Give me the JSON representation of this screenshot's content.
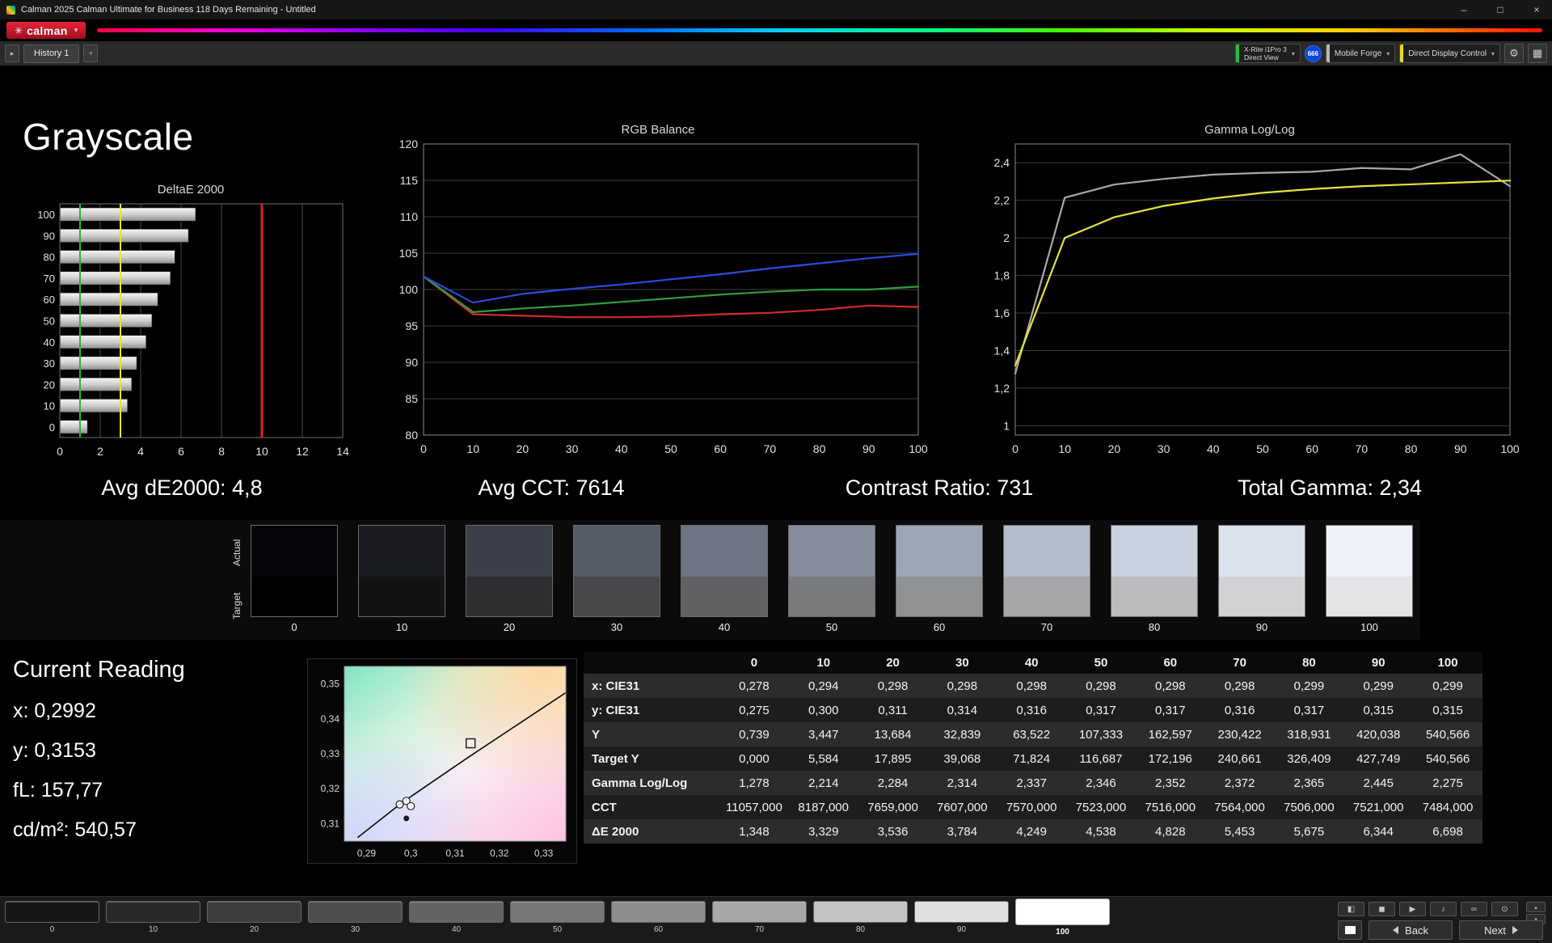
{
  "window": {
    "title": "Calman 2025 Calman Ultimate for Business 118 Days Remaining  - Untitled",
    "controls": {
      "minimize": "–",
      "maximize": "□",
      "close": "×"
    }
  },
  "brand": {
    "flower": "✳",
    "word": "calman",
    "chevron": "▾"
  },
  "toolbar": {
    "expander_glyph": "▸",
    "history_tab": "History 1",
    "add_glyph": "+",
    "meter_line1": "X-Rite i1Pro 3",
    "meter_line2": "Direct View",
    "meter_badge": "666",
    "source_label": "Mobile Forge",
    "display_label": "Direct Display Control",
    "chevron_glyph": "▾",
    "gear_glyph": "⚙",
    "layout_glyph": "▦"
  },
  "page_title": "Grayscale",
  "summary": {
    "avg_de": "Avg dE2000: 4,8",
    "avg_cct": "Avg CCT: 7614",
    "contrast": "Contrast Ratio: 731",
    "total_gamma": "Total Gamma: 2,34"
  },
  "current_reading": {
    "title": "Current Reading",
    "x": "x: 0,2992",
    "y": "y: 0,3153",
    "fl": "fL: 157,77",
    "cdm2": "cd/m²: 540,57"
  },
  "grayscale_swatches": {
    "actual_label": "Actual",
    "target_label": "Target",
    "levels": [
      "0",
      "10",
      "20",
      "30",
      "40",
      "50",
      "60",
      "70",
      "80",
      "90",
      "100"
    ],
    "actual_colors": [
      "#06070a",
      "#191b21",
      "#3a3f4a",
      "#545a66",
      "#6d7482",
      "#868e9d",
      "#9da6b5",
      "#b3bcca",
      "#c8d1de",
      "#dbe3ef",
      "#edf2fb"
    ],
    "target_colors": [
      "#000000",
      "#131314",
      "#2f2f31",
      "#48484a",
      "#616163",
      "#797a7c",
      "#909193",
      "#a7a7aa",
      "#bcbcbf",
      "#d1d1d4",
      "#e5e5e8"
    ]
  },
  "table": {
    "columns": [
      "",
      "0",
      "10",
      "20",
      "30",
      "40",
      "50",
      "60",
      "70",
      "80",
      "90",
      "100"
    ],
    "rows": [
      {
        "label": "x: CIE31",
        "values": [
          "0,278",
          "0,294",
          "0,298",
          "0,298",
          "0,298",
          "0,298",
          "0,298",
          "0,298",
          "0,299",
          "0,299",
          "0,299"
        ]
      },
      {
        "label": "y: CIE31",
        "values": [
          "0,275",
          "0,300",
          "0,311",
          "0,314",
          "0,316",
          "0,317",
          "0,317",
          "0,316",
          "0,317",
          "0,315",
          "0,315"
        ]
      },
      {
        "label": "Y",
        "values": [
          "0,739",
          "3,447",
          "13,684",
          "32,839",
          "63,522",
          "107,333",
          "162,597",
          "230,422",
          "318,931",
          "420,038",
          "540,566"
        ]
      },
      {
        "label": "Target Y",
        "values": [
          "0,000",
          "5,584",
          "17,895",
          "39,068",
          "71,824",
          "116,687",
          "172,196",
          "240,661",
          "326,409",
          "427,749",
          "540,566"
        ]
      },
      {
        "label": "Gamma Log/Log",
        "values": [
          "1,278",
          "2,214",
          "2,284",
          "2,314",
          "2,337",
          "2,346",
          "2,352",
          "2,372",
          "2,365",
          "2,445",
          "2,275"
        ]
      },
      {
        "label": "CCT",
        "values": [
          "11057,000",
          "8187,000",
          "7659,000",
          "7607,000",
          "7570,000",
          "7523,000",
          "7516,000",
          "7564,000",
          "7506,000",
          "7521,000",
          "7484,000"
        ]
      },
      {
        "label": "ΔE 2000",
        "values": [
          "1,348",
          "3,329",
          "3,536",
          "3,784",
          "4,249",
          "4,538",
          "4,828",
          "5,453",
          "5,675",
          "6,344",
          "6,698"
        ]
      }
    ]
  },
  "bottom_bar": {
    "levels": [
      "0",
      "10",
      "20",
      "30",
      "40",
      "50",
      "60",
      "70",
      "80",
      "90",
      "100"
    ],
    "colors": [
      "#161616",
      "#292929",
      "#3c3c3c",
      "#4f4f4f",
      "#636363",
      "#777777",
      "#8e8e8e",
      "#a8a8a8",
      "#c4c4c4",
      "#e0e0e0",
      "#ffffff"
    ],
    "selected_level": "100",
    "tools": [
      {
        "name": "split-display",
        "glyph": "◧"
      },
      {
        "name": "stop",
        "glyph": "◼"
      },
      {
        "name": "play",
        "glyph": "▶"
      },
      {
        "name": "audio",
        "glyph": "♪"
      },
      {
        "name": "loop",
        "glyph": "∞"
      },
      {
        "name": "power",
        "glyph": "⊙"
      }
    ],
    "corner": [
      {
        "name": "up",
        "glyph": "▴"
      },
      {
        "name": "down",
        "glyph": "▾"
      }
    ],
    "back_label": "Back",
    "next_label": "Next"
  },
  "chart_data": [
    {
      "type": "bar",
      "title": "DeltaE 2000",
      "orientation": "horizontal",
      "categories": [
        "100",
        "90",
        "80",
        "70",
        "60",
        "50",
        "40",
        "30",
        "20",
        "10",
        "0"
      ],
      "values": [
        6.698,
        6.344,
        5.675,
        5.453,
        4.828,
        4.538,
        4.249,
        3.784,
        3.536,
        3.329,
        1.348
      ],
      "xlim": [
        0,
        14
      ],
      "xticks": [
        0,
        2,
        4,
        6,
        8,
        10,
        12,
        14
      ],
      "reference_lines": [
        {
          "x": 1,
          "color": "#22b83c",
          "width": 2
        },
        {
          "x": 3,
          "color": "#e6e630",
          "width": 2
        },
        {
          "x": 10,
          "color": "#e02020",
          "width": 3
        }
      ]
    },
    {
      "type": "line",
      "title": "RGB Balance",
      "x": [
        0,
        10,
        20,
        30,
        40,
        50,
        60,
        70,
        80,
        90,
        100
      ],
      "ylim": [
        80,
        120
      ],
      "yticks": [
        80,
        85,
        90,
        95,
        100,
        105,
        110,
        115,
        120
      ],
      "xticks": [
        0,
        10,
        20,
        30,
        40,
        50,
        60,
        70,
        80,
        90,
        100
      ],
      "series": [
        {
          "name": "Red",
          "color": "#d42a2a",
          "values": [
            101.8,
            96.6,
            96.4,
            96.2,
            96.2,
            96.3,
            96.6,
            96.8,
            97.2,
            97.8,
            97.6
          ]
        },
        {
          "name": "Green",
          "color": "#2f9e3f",
          "values": [
            101.8,
            96.9,
            97.4,
            97.8,
            98.3,
            98.8,
            99.3,
            99.7,
            100.0,
            100.0,
            100.4
          ]
        },
        {
          "name": "Blue",
          "color": "#2a4ae0",
          "values": [
            101.8,
            98.2,
            99.4,
            100.1,
            100.7,
            101.4,
            102.1,
            102.9,
            103.6,
            104.3,
            104.9
          ]
        }
      ]
    },
    {
      "type": "line",
      "title": "Gamma Log/Log",
      "x": [
        0,
        10,
        20,
        30,
        40,
        50,
        60,
        70,
        80,
        90,
        100
      ],
      "ylim": [
        0.95,
        2.5
      ],
      "yticks": [
        1,
        1.2,
        1.4,
        1.6,
        1.8,
        2,
        2.2,
        2.4
      ],
      "ytick_labels": [
        "1",
        "1,2",
        "1,4",
        "1,6",
        "1,8",
        "2",
        "2,2",
        "2,4"
      ],
      "xticks": [
        0,
        10,
        20,
        30,
        40,
        50,
        60,
        70,
        80,
        90,
        100
      ],
      "series": [
        {
          "name": "Measured Gamma",
          "color": "#a8a8a8",
          "values": [
            1.278,
            2.214,
            2.284,
            2.314,
            2.337,
            2.346,
            2.352,
            2.372,
            2.365,
            2.445,
            2.275
          ]
        },
        {
          "name": "Target Gamma",
          "color": "#e8e33a",
          "values": [
            1.32,
            2.0,
            2.11,
            2.17,
            2.21,
            2.24,
            2.26,
            2.275,
            2.285,
            2.295,
            2.305
          ]
        }
      ]
    },
    {
      "type": "scatter",
      "xlim": [
        0.285,
        0.335
      ],
      "ylim": [
        0.305,
        0.355
      ],
      "xticks": [
        0.29,
        0.3,
        0.31,
        0.32,
        0.33
      ],
      "xtick_labels": [
        "0,29",
        "0,3",
        "0,31",
        "0,32",
        "0,33"
      ],
      "yticks": [
        0.31,
        0.32,
        0.33,
        0.34,
        0.35
      ],
      "ytick_labels": [
        "0,31",
        "0,32",
        "0,33",
        "0,34",
        "0,35"
      ],
      "locus_line": [
        [
          0.288,
          0.306
        ],
        [
          0.298,
          0.316
        ],
        [
          0.313,
          0.329
        ],
        [
          0.335,
          0.3475
        ]
      ],
      "target_square": [
        0.3135,
        0.333
      ],
      "points_open": [
        [
          0.2975,
          0.3155
        ],
        [
          0.299,
          0.3165
        ],
        [
          0.3,
          0.315
        ]
      ],
      "points_filled": [
        [
          0.299,
          0.3115
        ]
      ]
    }
  ]
}
